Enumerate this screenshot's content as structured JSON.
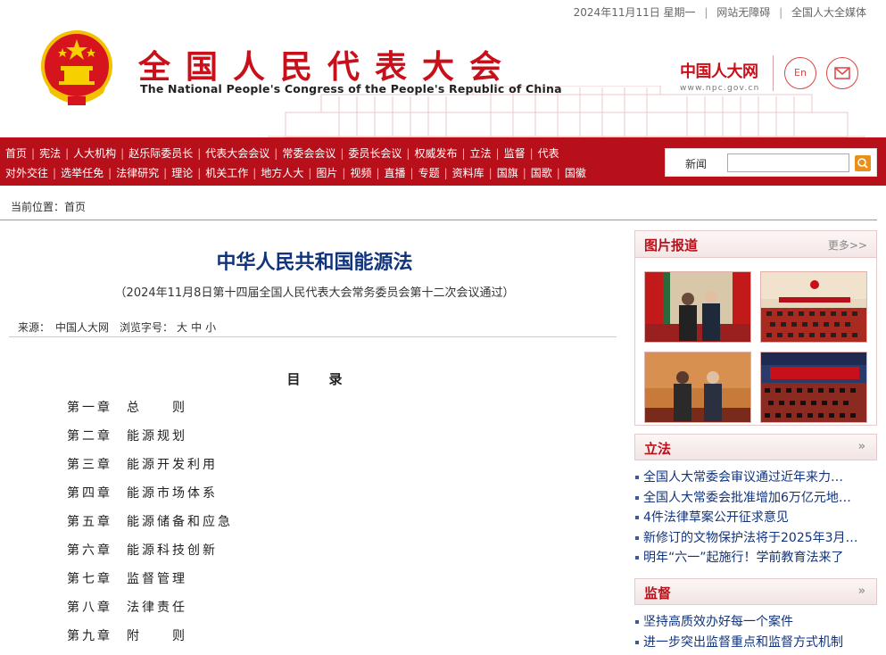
{
  "topbar": {
    "date": "2024年11月11日 星期一",
    "accessible": "网站无障碍",
    "media": "全国人大全媒体"
  },
  "header": {
    "cn_title": "全国人民代表大会",
    "en_title": "The National People's Congress of the People's Republic of China",
    "logo_name": "中国人大网",
    "logo_url": "www.npc.gov.cn",
    "en_button": "En",
    "mail_icon": "envelope-icon"
  },
  "nav": {
    "row1": [
      "首页",
      "宪法",
      "人大机构",
      "赵乐际委员长",
      "代表大会会议",
      "常委会会议",
      "委员长会议",
      "权威发布",
      "立法",
      "监督",
      "代表"
    ],
    "row2": [
      "对外交往",
      "选举任免",
      "法律研究",
      "理论",
      "机关工作",
      "地方人大",
      "图片",
      "视频",
      "直播",
      "专题",
      "资料库",
      "国旗",
      "国歌",
      "国徽"
    ],
    "search_label": "新闻",
    "search_value": "",
    "search_icon": "search-icon"
  },
  "breadcrumb": "当前位置：首页",
  "article": {
    "title": "中华人民共和国能源法",
    "subtitle": "（2024年11月8日第十四届全国人民代表大会常务委员会第十二次会议通过）",
    "source_label": "来源：",
    "source_value": "中国人大网",
    "fontsize_label": "浏览字号：",
    "font_large": "大",
    "font_medium": "中",
    "font_small": "小",
    "toc_heading": "目录",
    "toc": [
      {
        "ch": "第一章",
        "name": "总　　则"
      },
      {
        "ch": "第二章",
        "name": "能源规划"
      },
      {
        "ch": "第三章",
        "name": "能源开发利用"
      },
      {
        "ch": "第四章",
        "name": "能源市场体系"
      },
      {
        "ch": "第五章",
        "name": "能源储备和应急"
      },
      {
        "ch": "第六章",
        "name": "能源科技创新"
      },
      {
        "ch": "第七章",
        "name": "监督管理"
      },
      {
        "ch": "第八章",
        "name": "法律责任"
      },
      {
        "ch": "第九章",
        "name": "附　　则"
      }
    ]
  },
  "sidebar": {
    "pictures": {
      "title": "图片报道",
      "more": "更多>>"
    },
    "legislation": {
      "title": "立法",
      "items": [
        "全国人大常委会审议通过近年来力…",
        "全国人大常委会批准增加6万亿元地…",
        "4件法律草案公开征求意见",
        "新修订的文物保护法将于2025年3月…",
        "明年“六一”起施行！学前教育法来了"
      ]
    },
    "supervision": {
      "title": "监督",
      "items": [
        "坚持高质效办好每一个案件",
        "进一步突出监督重点和监督方式机制"
      ]
    }
  }
}
